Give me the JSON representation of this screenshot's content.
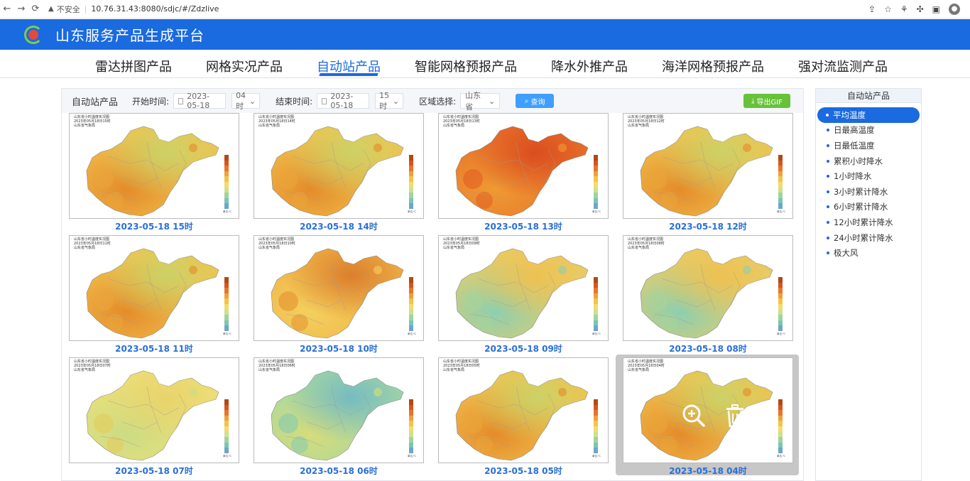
{
  "browser": {
    "insecure_label": "不安全",
    "url": "10.76.31.43:8080/sdjc/#/Zdzlive"
  },
  "app": {
    "title": "山东服务产品生成平台"
  },
  "nav": {
    "tabs": [
      "雷达拼图产品",
      "网格实况产品",
      "自动站产品",
      "智能网格预报产品",
      "降水外推产品",
      "海洋网格预报产品",
      "强对流监测产品"
    ],
    "active_index": 2
  },
  "toolbar": {
    "section": "自动站产品",
    "start_label": "开始时间:",
    "start_date": "2023-05-18",
    "start_hour": "04时",
    "end_label": "结束时间:",
    "end_date": "2023-05-18",
    "end_hour": "15时",
    "region_label": "区域选择:",
    "region_value": "山东省",
    "query_label": "查询",
    "gif_label": "导出GIF"
  },
  "cards": [
    {
      "caption": "2023-05-18 15时",
      "map_title": "山东省小时温度实况图",
      "sub": "2023年05月18日15时",
      "org": "山东省气象局",
      "theme": "warm"
    },
    {
      "caption": "2023-05-18 14时",
      "map_title": "山东省小时温度实况图",
      "sub": "2023年05月18日14时",
      "org": "山东省气象局",
      "theme": "warm"
    },
    {
      "caption": "2023-05-18 13时",
      "map_title": "山东省小时温度实况图",
      "sub": "2023年05月18日13时",
      "org": "山东省气象局",
      "theme": "hot"
    },
    {
      "caption": "2023-05-18 12时",
      "map_title": "山东省小时温度实况图",
      "sub": "2023年05月18日12时",
      "org": "山东省气象局",
      "theme": "warm"
    },
    {
      "caption": "2023-05-18 11时",
      "map_title": "山东省小时温度实况图",
      "sub": "2023年05月18日11时",
      "org": "山东省气象局",
      "theme": "warm"
    },
    {
      "caption": "2023-05-18 10时",
      "map_title": "山东省小时温度实况图",
      "sub": "2023年05月18日10时",
      "org": "山东省气象局",
      "theme": "warmer"
    },
    {
      "caption": "2023-05-18 09时",
      "map_title": "山东省小时温度实况图",
      "sub": "2023年05月18日09时",
      "org": "山东省气象局",
      "theme": "mild"
    },
    {
      "caption": "2023-05-18 08时",
      "map_title": "山东省小时温度实况图",
      "sub": "2023年05月18日08时",
      "org": "山东省气象局",
      "theme": "mild"
    },
    {
      "caption": "2023-05-18 07时",
      "map_title": "山东省小时温度实况图",
      "sub": "2023年05月18日07时",
      "org": "山东省气象局",
      "theme": "yellow"
    },
    {
      "caption": "2023-05-18 06时",
      "map_title": "山东省小时温度实况图",
      "sub": "2023年05月18日06时",
      "org": "山东省气象局",
      "theme": "cool"
    },
    {
      "caption": "2023-05-18 05时",
      "map_title": "山东省小时温度实况图",
      "sub": "2023年05月18日05时",
      "org": "山东省气象局",
      "theme": "warm"
    },
    {
      "caption": "2023-05-18 04时",
      "map_title": "山东省小时温度实况图",
      "sub": "2023年05月18日04时",
      "org": "山东省气象局",
      "theme": "warm"
    }
  ],
  "legend_unit": "单位:℃",
  "side": {
    "title": "自动站产品",
    "items": [
      "平均温度",
      "日最高温度",
      "日最低温度",
      "累积小时降水",
      "1小时降水",
      "3小时累计降水",
      "6小时累计降水",
      "12小时累计降水",
      "24小时累计降水",
      "极大风"
    ],
    "active_index": 0
  },
  "colors": {
    "brand_blue": "#1a6ae0",
    "caption_blue": "#2a6fd6",
    "query_blue": "#409eff",
    "gif_green": "#67c23a"
  }
}
